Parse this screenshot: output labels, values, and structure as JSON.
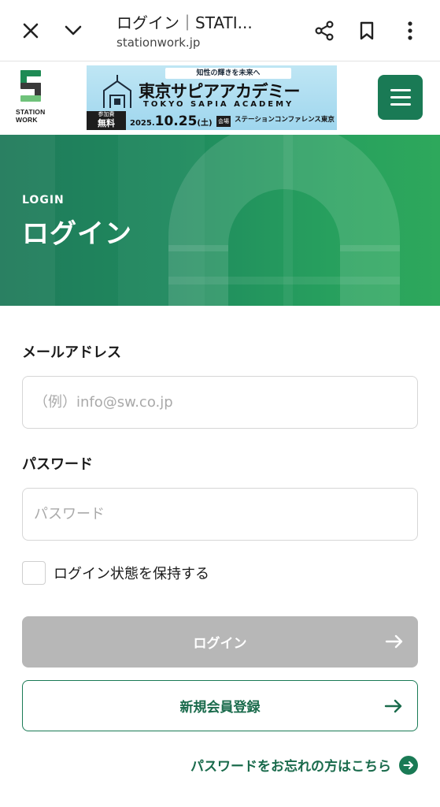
{
  "browser": {
    "title": "ログイン｜STATI...",
    "url": "stationwork.jp",
    "icons": [
      "close-icon",
      "chevron-down-icon",
      "share-icon",
      "bookmark-icon",
      "more-vert-icon"
    ]
  },
  "header": {
    "logo_line1": "STATION",
    "logo_line2": "WORK",
    "banner": {
      "tagline": "知性の輝きを未来へ",
      "headline": "東京サピアアカデミー",
      "subtitle": "TOKYO SAPIA ACADEMY",
      "badge_top": "参加費",
      "badge_main": "無料",
      "date_year": "2025.",
      "date_main": "10.25",
      "date_weekday": "(土)",
      "venue_tag": "会場",
      "venue": "ステーションコンファレンス東京"
    },
    "menu_icon": "menu-icon"
  },
  "hero": {
    "eyebrow": "LOGIN",
    "title": "ログイン"
  },
  "form": {
    "email_label": "メールアドレス",
    "email_placeholder": "（例）info@sw.co.jp",
    "email_value": "",
    "password_label": "パスワード",
    "password_placeholder": "パスワード",
    "password_value": "",
    "remember_label": "ログイン状態を保持する",
    "remember_checked": false,
    "login_button": "ログイン",
    "register_button": "新規会員登録",
    "forgot_link": "パスワードをお忘れの方はこちら"
  },
  "colors": {
    "brand_green": "#1a7a55",
    "hero_green_start": "#1f7a5a",
    "hero_green_end": "#2ea85c",
    "disabled_button": "#b7b7b7"
  }
}
